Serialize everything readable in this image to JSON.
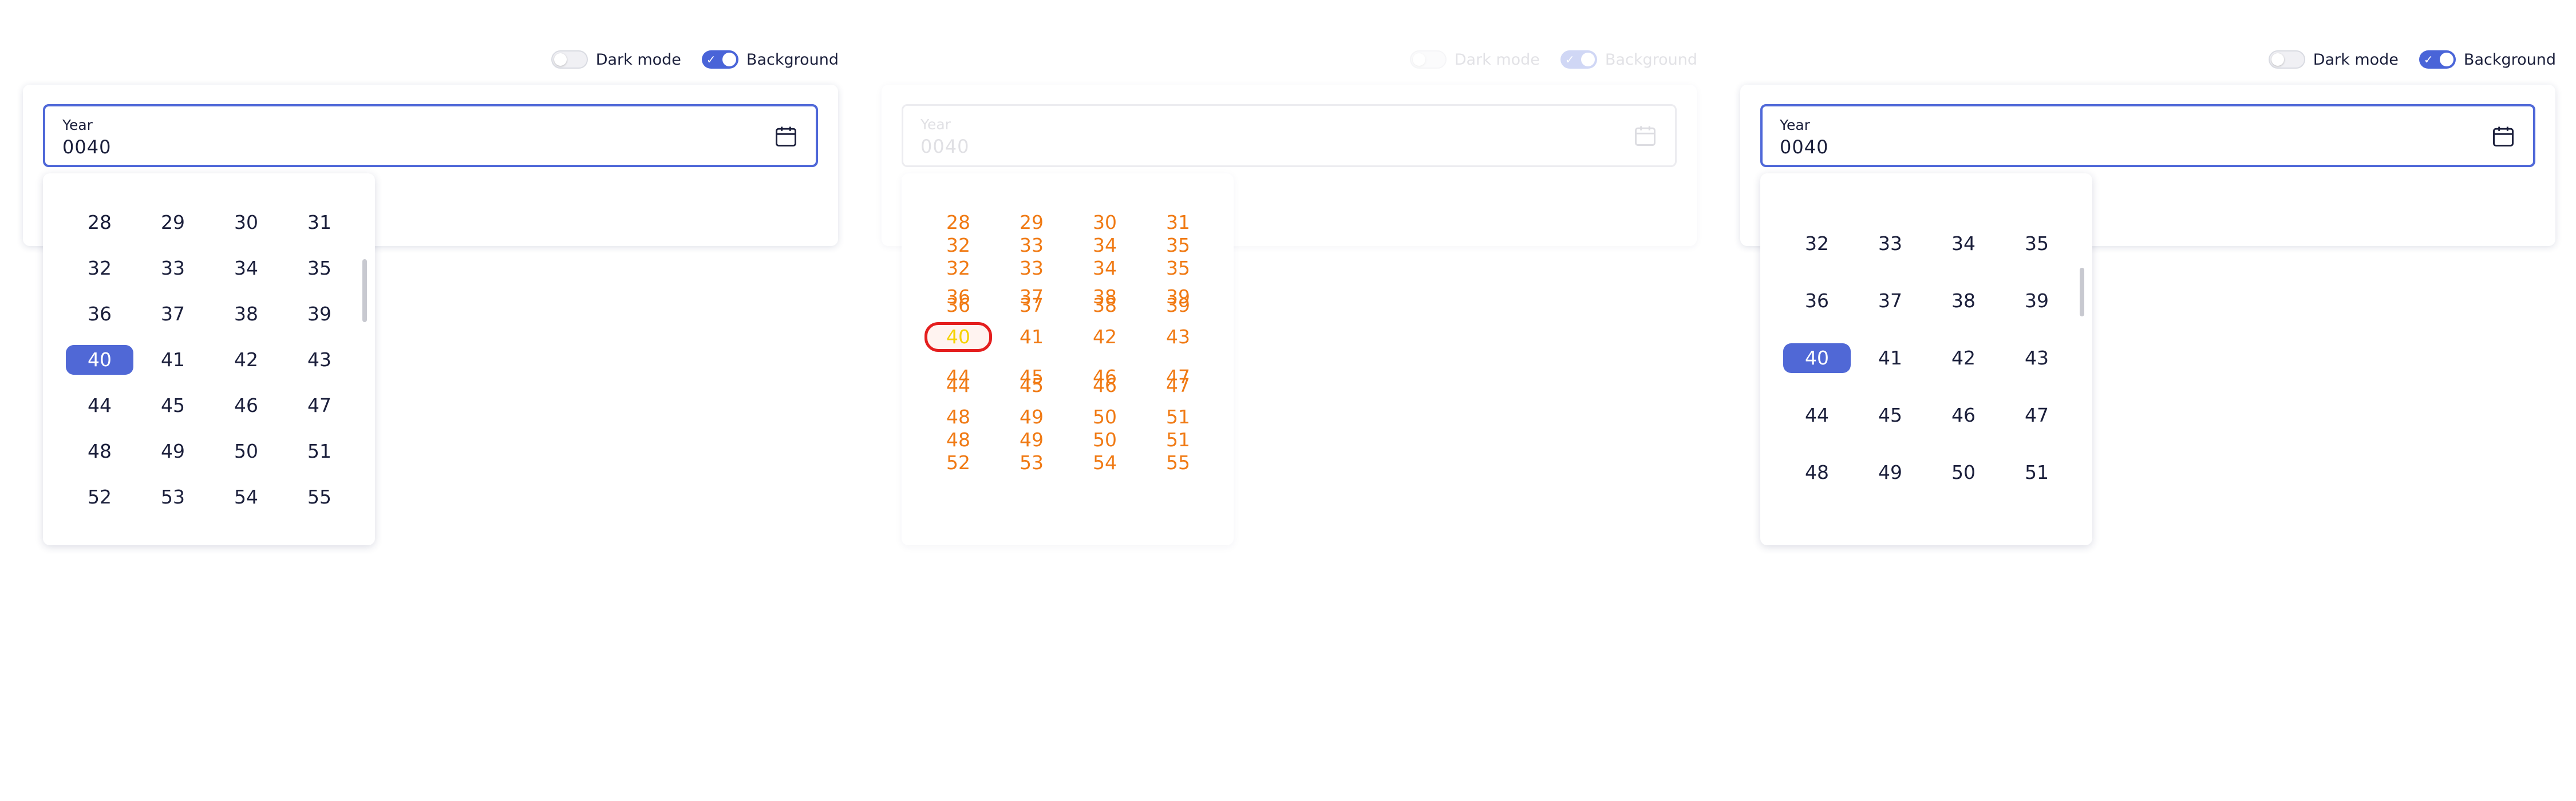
{
  "toggles": {
    "dark_mode": {
      "label": "Dark mode",
      "on": false
    },
    "background": {
      "label": "Background",
      "on": true
    }
  },
  "field": {
    "label": "Year",
    "value": "0040"
  },
  "icons": {
    "calendar": "calendar-icon",
    "check": "check-icon"
  },
  "colors": {
    "accent": "#4f68d8",
    "selected_bg": "#5068d6",
    "ghost_text": "#f07a14",
    "ghost_ring": "#e41e1e"
  },
  "left_picker": {
    "rows": [
      [
        "28",
        "29",
        "30",
        "31"
      ],
      [
        "32",
        "33",
        "34",
        "35"
      ],
      [
        "36",
        "37",
        "38",
        "39"
      ],
      [
        "40",
        "41",
        "42",
        "43"
      ],
      [
        "44",
        "45",
        "46",
        "47"
      ],
      [
        "48",
        "49",
        "50",
        "51"
      ],
      [
        "52",
        "53",
        "54",
        "55"
      ]
    ],
    "selected": "40"
  },
  "mid_ghost": {
    "lines": [
      [
        "28",
        "29",
        "30",
        "31"
      ],
      [
        "32",
        "33",
        "34",
        "35"
      ],
      [
        "32",
        "33",
        "34",
        "35"
      ],
      [
        "36",
        "37",
        "38",
        "39"
      ],
      [
        "36",
        "37",
        "38",
        "39"
      ],
      [
        "40",
        "41",
        "42",
        "43"
      ],
      [
        "44",
        "45",
        "46",
        "47"
      ],
      [
        "44",
        "45",
        "46",
        "47"
      ],
      [
        "48",
        "49",
        "50",
        "51"
      ],
      [
        "48",
        "49",
        "50",
        "51"
      ],
      [
        "52",
        "53",
        "54",
        "55"
      ]
    ]
  },
  "right_picker": {
    "rows": [
      [
        "32",
        "33",
        "34",
        "35"
      ],
      [
        "36",
        "37",
        "38",
        "39"
      ],
      [
        "40",
        "41",
        "42",
        "43"
      ],
      [
        "44",
        "45",
        "46",
        "47"
      ],
      [
        "48",
        "49",
        "50",
        "51"
      ]
    ],
    "selected": "40"
  }
}
